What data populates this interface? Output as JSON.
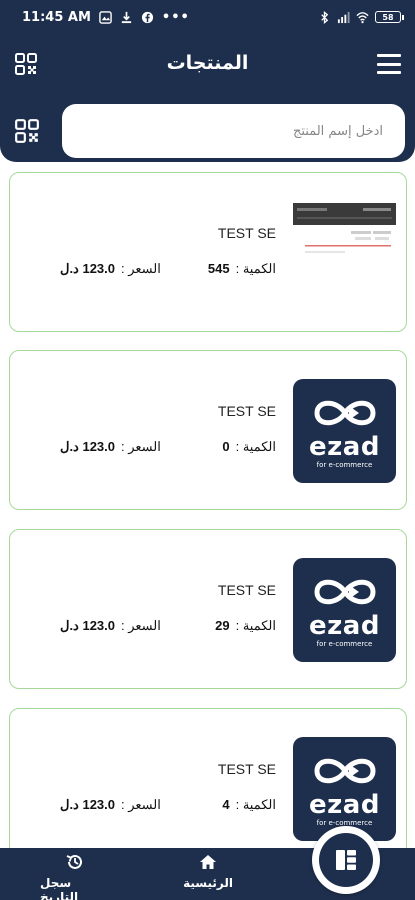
{
  "status_bar": {
    "time": "11:45 AM",
    "battery": "58"
  },
  "header": {
    "title": "المنتجات"
  },
  "search": {
    "placeholder": "ادخل إسم المنتج"
  },
  "products": [
    {
      "name": "TEST SE",
      "qty_label": "الكمية :",
      "qty": "545",
      "price_label": "السعر :",
      "price": "123.0 د.ل",
      "image": "screenshot"
    },
    {
      "name": "TEST SE",
      "qty_label": "الكمية :",
      "qty": "0",
      "price_label": "السعر :",
      "price": "123.0 د.ل",
      "image": "ezad-logo"
    },
    {
      "name": "TEST SE",
      "qty_label": "الكمية :",
      "qty": "29",
      "price_label": "السعر :",
      "price": "123.0 د.ل",
      "image": "ezad-logo"
    },
    {
      "name": "TEST SE",
      "qty_label": "الكمية :",
      "qty": "4",
      "price_label": "السعر :",
      "price": "123.0 د.ل",
      "image": "ezad-logo"
    }
  ],
  "logo": {
    "brand": "ezad",
    "sub": "for e-commerce"
  },
  "bottom_nav": {
    "history_label": "سجل التاريخ",
    "home_label": "الرئيسية"
  },
  "colors": {
    "primary": "#1e2f4d",
    "card_border": "#a8d89a"
  }
}
